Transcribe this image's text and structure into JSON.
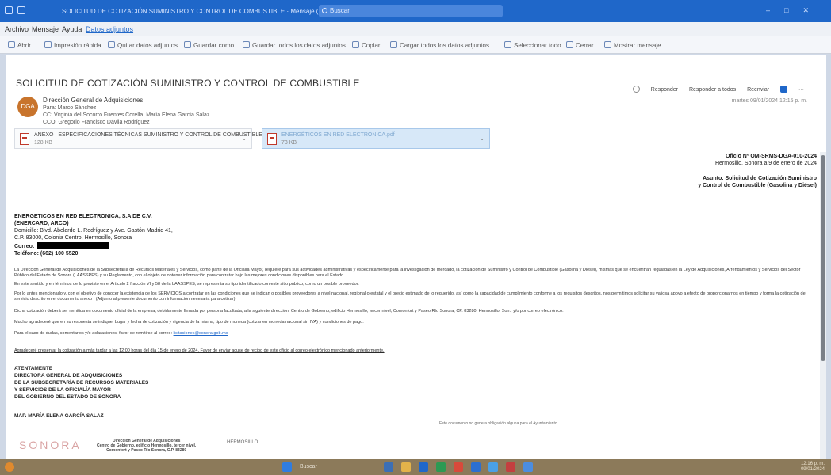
{
  "window": {
    "title": "SOLICITUD DE COTIZACIÓN SUMINISTRO Y CONTROL DE COMBUSTIBLE · Mensaje (HTML)",
    "search_placeholder": "Buscar"
  },
  "menubar": {
    "items": [
      "Archivo",
      "Mensaje",
      "Ayuda",
      "Datos adjuntos"
    ]
  },
  "ribbon": {
    "items": [
      "Abrir",
      "Impresión rápida",
      "Quitar datos adjuntos",
      "Guardar como",
      "Guardar todos los datos adjuntos",
      "Copiar",
      "Cargar todos los datos adjuntos",
      "Seleccionar todo",
      "Cerrar",
      "Mostrar mensaje"
    ]
  },
  "email": {
    "subject": "SOLICITUD DE COTIZACIÓN SUMINISTRO Y CONTROL DE COMBUSTIBLE",
    "avatar_initials": "DGA",
    "from": "Dirección General de Adquisiciones",
    "to": "Para: Marco Sánchez",
    "cc": "CC: Virginia del Socorro Fuentes Corella; María Elena García Salaz",
    "cco": "CCO: Gregorio Francisco Dávila Rodríguez",
    "date": "martes 09/01/2024 12:15 p. m.",
    "actions": [
      "Responder",
      "Responder a todos",
      "Reenviar"
    ],
    "attachments": [
      {
        "name": "ANEXO I ESPECIFICACIONES TÉCNICAS SUMINISTRO Y CONTROL DE COMBUSTIBLE.pdf",
        "size": "128 KB"
      },
      {
        "name": "ENERGÉTICOS EN RED ELECTRÓNICA.pdf",
        "size": "73 KB"
      }
    ]
  },
  "letter": {
    "oficio": "Oficio Nº OM-SRMS-DGA-010-2024",
    "place_date": "Hermosillo, Sonora a 9 de enero de 2024",
    "asunto_1": "Asunto: Solicitud de Cotización Suministro",
    "asunto_2": "y Control de Combustible (Gasolina y Diésel)",
    "company_1": "ENERGETICOS EN RED ELECTRONICA, S.A DE C.V.",
    "company_2": "(ENERCARD, ARCO)",
    "domicilio": "Domicilio: Blvd. Abelardo L. Rodríguez y Ave. Gastón Madrid 41,",
    "cp": "C.P. 83000, Colonia Centro, Hermosillo, Sonora",
    "correo_label": "Correo:",
    "telefono": "Teléfono: (662) 100 5520",
    "p1": "La Dirección General de Adquisiciones de la Subsecretaría de Recursos Materiales y Servicios, como parte de la Oficialía Mayor, requiere para sus actividades administrativas y específicamente para la investigación de mercado, la cotización de Suministro y Control de Combustible (Gasolina y Diésel), mismas que se encuentran reguladas en la Ley de Adquisiciones, Arrendamientos y Servicios del Sector Público del Estado de Sonora (LAASSPES) y su Reglamento, con el objeto de obtener información para contratar bajo las mejores condiciones disponibles para el Estado.",
    "p2": "En este sentido y en términos de lo previsto en el Artículo 2 fracción VI y 58 de la LAASSPES, se representa su tipo identificado con este sitio público, como un posible proveedor.",
    "p3": "Por lo antes mencionado y, con el objetivo de conocer la existencia de los SERVICIOS a contratar en las condiciones que se indican o posibles proveedores a nivel nacional, regional o estatal y el precio estimado de lo requerido, así como la capacidad de cumplimiento conforme a los requisitos descritos, nos permitimos solicitar su valiosa apoyo a efecto de proporcionarnos en tiempo y forma la cotización del servicio descrito en el documento anexo I (Adjunto al presente documento con información necesaria para cotizar).",
    "p4": "Dicha cotización deberá ser remitida en documento oficial de la empresa, debidamente firmada por persona facultada, a la siguiente dirección: Centro de Gobierno, edificio Hermosillo, tercer nivel, Comonfort y Paseo Río Sonora, CP. 83280, Hermosillo, Son., y/o por correo electrónico.",
    "p5": "Mucho agradeceré que en su respuesta se indique: Lugar y fecha de cotización y vigencia de la misma, tipo de moneda (cotizar en moneda nacional sin IVA) y condiciones de pago.",
    "p6_text": "Para el caso de dudas, comentarios y/o aclaraciones, favor de remitirse al correo:",
    "p6_link": "licitaciones@sonora.gob.mx",
    "p7": "Agradeceré presentar la cotización a más tardar a las 12:00 horas del día 15 de enero de 2024. Favor de enviar acuse de recibo de este oficio al correo electrónico mencionado anteriormente.",
    "sig_1": "ATENTAMENTE",
    "sig_2": "DIRECTORA GENERAL DE ADQUISICIONES",
    "sig_3": "DE LA SUBSECRETARÍA DE RECURSOS MATERIALES",
    "sig_4": "Y SERVICIOS DE LA OFICIALÍA MAYOR",
    "sig_5": "DEL GOBIERNO DEL ESTADO DE SONORA",
    "sig_name": "MAP. MARÍA ELENA GARCÍA SALAZ",
    "footer_right": "Este documento no genera obligación alguna para el Ayuntamiento",
    "footer_logo": "SONORA",
    "footer_1": "Dirección General de Adquisiciones",
    "footer_2": "Centro de Gobierno, edificio Hermosillo, tercer nivel,",
    "footer_3": "Comonfort y Paseo Río Sonora, C.P. 83280",
    "footer_marks": "HERMOSILLO"
  },
  "taskbar": {
    "search_label": "Buscar",
    "time": "12:16 p. m.",
    "date": "09/01/2024"
  },
  "colors": {
    "titlebar": "#1f67c9",
    "taskbar": "#8c7a5a",
    "link": "#1f67c9"
  }
}
